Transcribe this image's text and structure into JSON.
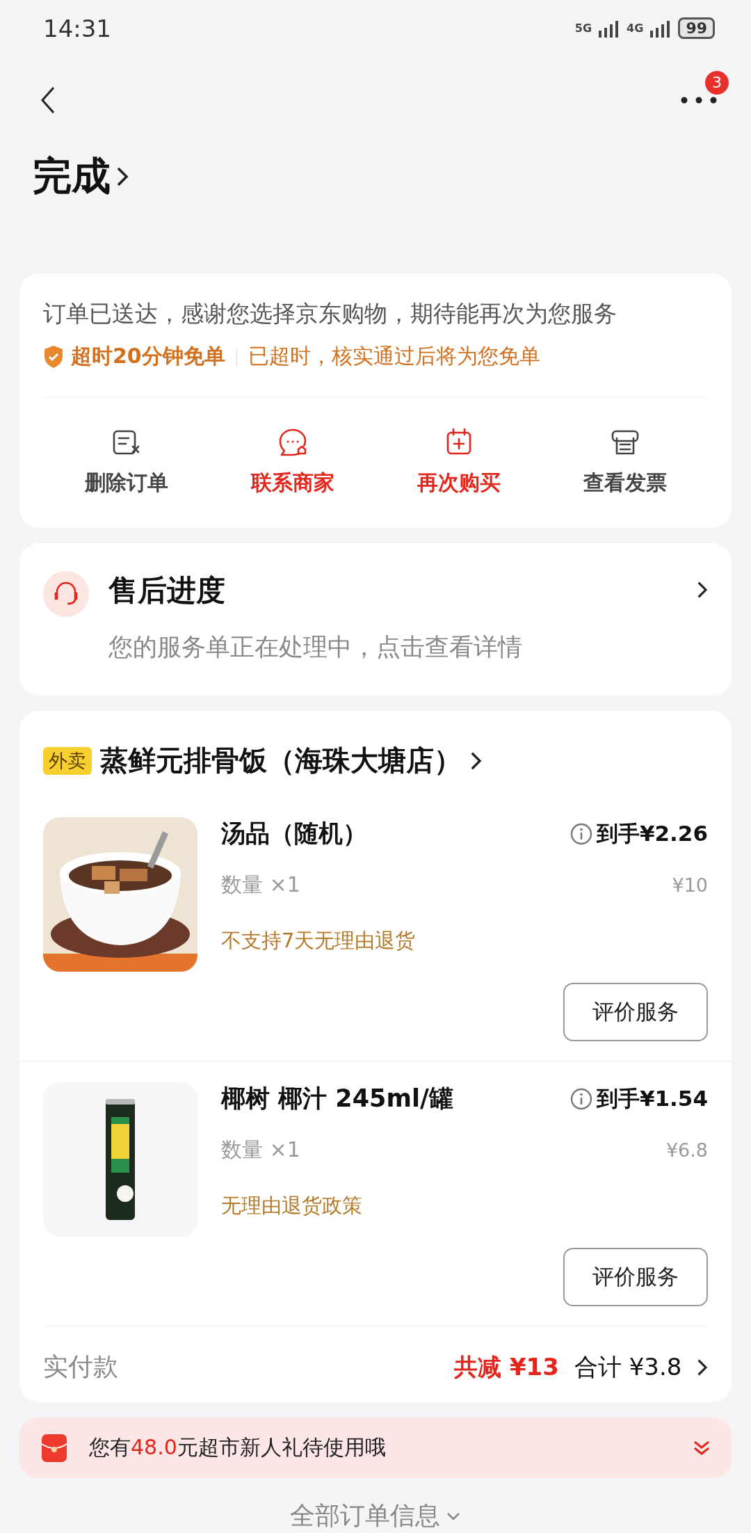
{
  "status_bar": {
    "time": "14:31",
    "network_1": "5G",
    "network_2": "4G",
    "battery": "99"
  },
  "nav": {
    "badge": "3"
  },
  "title": "完成",
  "order_card": {
    "message": "订单已送达，感谢您选择京东购物，期待能再次为您服务",
    "guarantee_title": "超时20分钟免单",
    "guarantee_detail": "已超时，核实通过后将为您免单",
    "actions": [
      {
        "label": "删除订单",
        "kind": "delete",
        "highlighted": false
      },
      {
        "label": "联系商家",
        "kind": "contact",
        "highlighted": true
      },
      {
        "label": "再次购买",
        "kind": "rebuy",
        "highlighted": true
      },
      {
        "label": "查看发票",
        "kind": "invoice",
        "highlighted": false
      }
    ]
  },
  "after_sales": {
    "title": "售后进度",
    "subtitle": "您的服务单正在处理中，点击查看详情"
  },
  "store": {
    "tag": "外卖",
    "name": "蒸鲜元排骨饭（海珠大塘店）"
  },
  "items": [
    {
      "kind": "bowl",
      "name": "汤品（随机）",
      "quantity": "数量 ×1",
      "policy": "不支持7天无理由退货",
      "price_label": "到手",
      "price": "¥2.26",
      "original_price": "¥10",
      "button": "评价服务"
    },
    {
      "kind": "can",
      "name": "椰树 椰汁 245ml/罐",
      "quantity": "数量 ×1",
      "policy": "无理由退货政策",
      "price_label": "到手",
      "price": "¥1.54",
      "original_price": "¥6.8",
      "button": "评价服务"
    }
  ],
  "payment": {
    "label": "实付款",
    "discount": "共减 ¥13",
    "total": "合计 ¥3.8"
  },
  "promo": {
    "before": "您有",
    "amount": "48.0",
    "after": "元超市新人礼待使用哦"
  },
  "footer": {
    "label": "全部订单信息"
  }
}
